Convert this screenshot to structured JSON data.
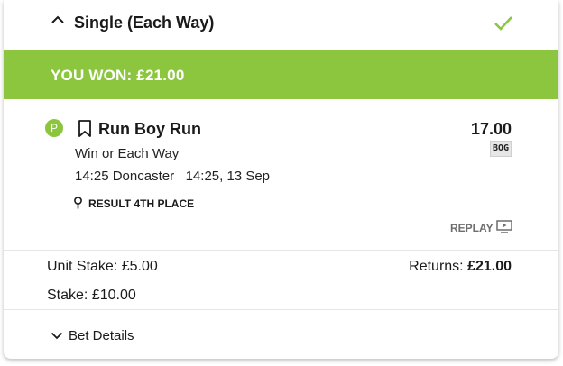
{
  "bet": {
    "title": "Single (Each Way)",
    "status_icon": "checkmark-icon",
    "banner_text": "YOU WON: £21.00",
    "colors": {
      "accent": "#8cc63f",
      "text": "#1a1a1a",
      "muted": "#6d6d6d"
    }
  },
  "selection": {
    "status_badge": "P",
    "name": "Run Boy Run",
    "odds": "17.00",
    "odds_tag": "BOG",
    "market": "Win or Each Way",
    "event": "14:25 Doncaster",
    "event_time": "14:25, 13 Sep",
    "result": "RESULT 4TH PLACE",
    "replay_label": "REPLAY"
  },
  "summary": {
    "unit_stake_label": "Unit Stake:",
    "unit_stake_value": "£5.00",
    "returns_label": "Returns:",
    "returns_value": "£21.00",
    "stake_label": "Stake:",
    "stake_value": "£10.00"
  },
  "footer": {
    "details_label": "Bet Details"
  }
}
